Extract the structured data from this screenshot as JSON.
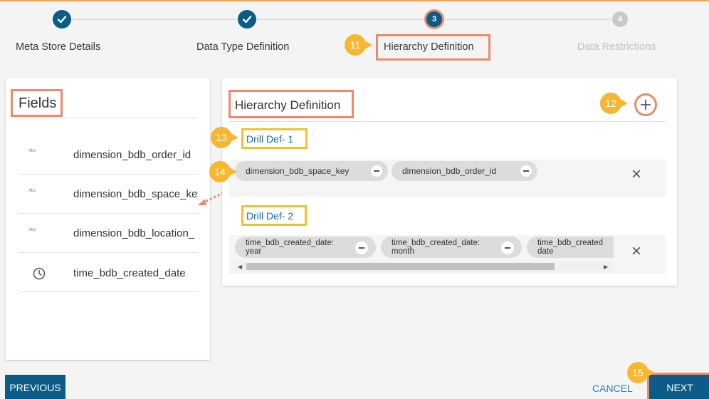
{
  "stepper": {
    "steps": [
      {
        "label": "Meta Store Details",
        "status": "done"
      },
      {
        "label": "Data Type Definition",
        "status": "done"
      },
      {
        "label": "Hierarchy Definition",
        "status": "current",
        "number": "3"
      },
      {
        "label": "Data Restrictions",
        "status": "todo",
        "number": "4"
      }
    ]
  },
  "callouts": {
    "c11": "11",
    "c12": "12",
    "c13": "13",
    "c14": "14",
    "c15": "15"
  },
  "fields_panel": {
    "title": "Fields",
    "items": [
      {
        "type": "Abc",
        "name": "dimension_bdb_order_id",
        "icon": "text-type-icon"
      },
      {
        "type": "Abc",
        "name": "dimension_bdb_space_key",
        "icon": "text-type-icon"
      },
      {
        "type": "Abc",
        "name": "dimension_bdb_location_",
        "icon": "text-type-icon"
      },
      {
        "type": "",
        "name": "time_bdb_created_date",
        "icon": "clock-icon"
      }
    ]
  },
  "hierarchy_panel": {
    "title": "Hierarchy Definition",
    "drills": [
      {
        "label": "Drill Def- 1",
        "chips": [
          "dimension_bdb_space_key",
          "dimension_bdb_order_id"
        ]
      },
      {
        "label": "Drill Def- 2",
        "chips": [
          {
            "line1": "time_bdb_created_date:",
            "line2": "year"
          },
          {
            "line1": "time_bdb_created_date:",
            "line2": "month"
          },
          {
            "line1": "time_bdb_created",
            "line2": "date"
          }
        ]
      }
    ]
  },
  "footer": {
    "previous": "PREVIOUS",
    "cancel": "CANCEL",
    "next": "NEXT"
  },
  "colors": {
    "primary": "#0b5c86",
    "highlight_orange": "#ee8a6b",
    "highlight_yellow": "#f2c12e",
    "callout": "#f7b733",
    "link": "#1c6aa0"
  }
}
